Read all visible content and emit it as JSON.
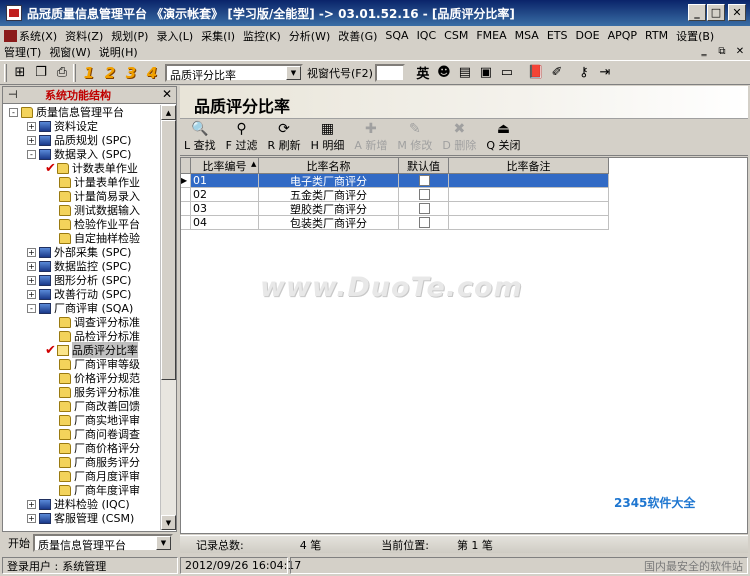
{
  "window": {
    "title": "品冠质量信息管理平台 《演示帐套》 [学习版/全能型] -> 03.01.52.16 - [品质评分比率]"
  },
  "menu_row1": [
    "系统(X)",
    "资料(Z)",
    "规划(P)",
    "录入(L)",
    "采集(I)",
    "监控(K)",
    "分析(W)",
    "改善(G)",
    "SQA",
    "IQC",
    "CSM",
    "FMEA",
    "MSA",
    "ETS",
    "DOE",
    "APQP",
    "RTM",
    "设置(B)"
  ],
  "menu_row2": [
    "管理(T)",
    "视窗(W)",
    "说明(H)"
  ],
  "toolbar": {
    "numbers": [
      "1",
      "2",
      "3",
      "4"
    ],
    "combo_value": "品质评分比率",
    "window_code_label": "视窗代号(F2)",
    "lang_label": "英"
  },
  "sidebar": {
    "title": "系统功能结构",
    "tree": [
      {
        "label": "质量信息管理平台",
        "level": 0,
        "pm": "-",
        "icon": "folder"
      },
      {
        "label": "资料设定",
        "level": 1,
        "pm": "+",
        "icon": "doc"
      },
      {
        "label": "品质规划 (SPC)",
        "level": 1,
        "pm": "+",
        "icon": "doc"
      },
      {
        "label": "数据录入 (SPC)",
        "level": 1,
        "pm": "-",
        "icon": "doc"
      },
      {
        "label": "计数表单作业",
        "level": 2,
        "icon": "folder",
        "check": true
      },
      {
        "label": "计量表单作业",
        "level": 2,
        "icon": "folder"
      },
      {
        "label": "计量简易录入",
        "level": 2,
        "icon": "folder"
      },
      {
        "label": "测试数据输入",
        "level": 2,
        "icon": "folder"
      },
      {
        "label": "检验作业平台",
        "level": 2,
        "icon": "folder"
      },
      {
        "label": "自定抽样检验",
        "level": 2,
        "icon": "folder"
      },
      {
        "label": "外部采集 (SPC)",
        "level": 1,
        "pm": "+",
        "icon": "doc"
      },
      {
        "label": "数据监控 (SPC)",
        "level": 1,
        "pm": "+",
        "icon": "doc"
      },
      {
        "label": "图形分析 (SPC)",
        "level": 1,
        "pm": "+",
        "icon": "doc"
      },
      {
        "label": "改善行动 (SPC)",
        "level": 1,
        "pm": "+",
        "icon": "doc"
      },
      {
        "label": "厂商评审 (SQA)",
        "level": 1,
        "pm": "-",
        "icon": "doc"
      },
      {
        "label": "调查评分标准",
        "level": 2,
        "icon": "folder"
      },
      {
        "label": "品检评分标准",
        "level": 2,
        "icon": "folder"
      },
      {
        "label": "品质评分比率",
        "level": 2,
        "icon": "open-folder",
        "check": true,
        "selected": true
      },
      {
        "label": "厂商评审等级",
        "level": 2,
        "icon": "folder"
      },
      {
        "label": "价格评分规范",
        "level": 2,
        "icon": "folder"
      },
      {
        "label": "服务评分标准",
        "level": 2,
        "icon": "folder"
      },
      {
        "label": "厂商改善回馈",
        "level": 2,
        "icon": "folder"
      },
      {
        "label": "厂商实地评审",
        "level": 2,
        "icon": "folder"
      },
      {
        "label": "厂商问卷调查",
        "level": 2,
        "icon": "folder"
      },
      {
        "label": "厂商价格评分",
        "level": 2,
        "icon": "folder"
      },
      {
        "label": "厂商服务评分",
        "level": 2,
        "icon": "folder"
      },
      {
        "label": "厂商月度评审",
        "level": 2,
        "icon": "folder"
      },
      {
        "label": "厂商年度评审",
        "level": 2,
        "icon": "folder"
      },
      {
        "label": "进料检验 (IQC)",
        "level": 1,
        "pm": "+",
        "icon": "doc"
      },
      {
        "label": "客服管理 (CSM)",
        "level": 1,
        "pm": "+",
        "icon": "doc"
      }
    ]
  },
  "start": {
    "label": "开始",
    "value": "质量信息管理平台"
  },
  "page": {
    "title": "品质评分比率"
  },
  "actions": [
    {
      "key": "find",
      "icon": "🔍",
      "label": "L 查找",
      "enabled": true
    },
    {
      "key": "filter",
      "icon": "⚲",
      "label": "F 过滤",
      "enabled": true
    },
    {
      "key": "refresh",
      "icon": "⟳",
      "label": "R 刷新",
      "enabled": true
    },
    {
      "key": "detail",
      "icon": "▦",
      "label": "H 明细",
      "enabled": true
    },
    {
      "key": "add",
      "icon": "✚",
      "label": "A 新增",
      "enabled": false
    },
    {
      "key": "edit",
      "icon": "✎",
      "label": "M 修改",
      "enabled": false
    },
    {
      "key": "delete",
      "icon": "✖",
      "label": "D 删除",
      "enabled": false
    },
    {
      "key": "close",
      "icon": "⏏",
      "label": "Q 关闭",
      "enabled": true
    }
  ],
  "grid": {
    "columns": [
      "比率编号",
      "比率名称",
      "默认值",
      "比率备注"
    ],
    "rows": [
      {
        "code": "01",
        "name": "电子类厂商评分",
        "default": true,
        "remark": "",
        "selected": true
      },
      {
        "code": "02",
        "name": "五金类厂商评分",
        "default": false,
        "remark": ""
      },
      {
        "code": "03",
        "name": "塑胶类厂商评分",
        "default": false,
        "remark": ""
      },
      {
        "code": "04",
        "name": "包装类厂商评分",
        "default": false,
        "remark": ""
      }
    ]
  },
  "footer": {
    "total_label": "记录总数:",
    "total_value": "4 笔",
    "position_label": "当前位置:",
    "position_value": "第 1 笔"
  },
  "statusbar": {
    "user_label": "登录用户 :",
    "user_value": "系统管理",
    "datetime": "2012/09/26 16:04:17",
    "security_text": "国内最安全的软件站"
  },
  "watermark": "www.DuoTe.com",
  "logo_2345": "2345软件大全",
  "colors": {
    "selection": "#316ac5",
    "title_bar": "#0a246a",
    "sidebar_title": "#c00000"
  }
}
